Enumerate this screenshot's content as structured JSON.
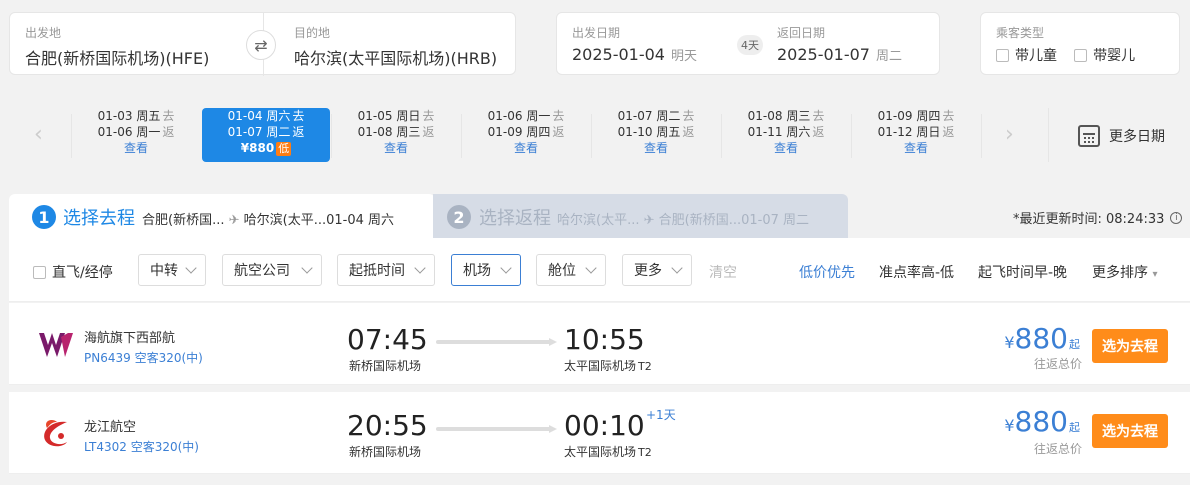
{
  "search": {
    "from_label": "出发地",
    "from_value": "合肥(新桥国际机场)(HFE)",
    "to_label": "目的地",
    "to_value": "哈尔滨(太平国际机场)(HRB)",
    "depart_label": "出发日期",
    "depart_date": "2025-01-04",
    "depart_day": "明天",
    "days_count": "4天",
    "return_label": "返回日期",
    "return_date": "2025-01-07",
    "return_day": "周二",
    "pax_label": "乘客类型",
    "pax_child": "带儿童",
    "pax_infant": "带婴儿"
  },
  "date_strip": {
    "cells": [
      {
        "go": "01-03 周五",
        "go_tag": "去",
        "ret": "01-06 周一",
        "ret_tag": "返",
        "action": "查看"
      },
      {
        "go": "01-04 周六",
        "go_tag": "去",
        "ret": "01-07 周二",
        "ret_tag": "返",
        "price": "¥880",
        "low": "低"
      },
      {
        "go": "01-05 周日",
        "go_tag": "去",
        "ret": "01-08 周三",
        "ret_tag": "返",
        "action": "查看"
      },
      {
        "go": "01-06 周一",
        "go_tag": "去",
        "ret": "01-09 周四",
        "ret_tag": "返",
        "action": "查看"
      },
      {
        "go": "01-07 周二",
        "go_tag": "去",
        "ret": "01-10 周五",
        "ret_tag": "返",
        "action": "查看"
      },
      {
        "go": "01-08 周三",
        "go_tag": "去",
        "ret": "01-11 周六",
        "ret_tag": "返",
        "action": "查看"
      },
      {
        "go": "01-09 周四",
        "go_tag": "去",
        "ret": "01-12 周日",
        "ret_tag": "返",
        "action": "查看"
      }
    ],
    "more_dates": "更多日期"
  },
  "steps": {
    "step1_num": "1",
    "step1_title": "选择去程",
    "step1_route": "合肥(新桥国...",
    "step1_route_to": "哈尔滨(太平...01-04 周六",
    "step2_num": "2",
    "step2_title": "选择返程",
    "step2_route": "哈尔滨(太平...",
    "step2_route_to": "合肥(新桥国...01-07 周二",
    "update_text": "*最近更新时间: 08:24:33",
    "info_icon": "i"
  },
  "filters": {
    "direct": "直飞/经停",
    "transfer": "中转",
    "airline": "航空公司",
    "time": "起抵时间",
    "airport": "机场",
    "cabin": "舱位",
    "more": "更多",
    "clear": "清空",
    "sort_low": "低价优先",
    "sort_ontime": "准点率高-低",
    "sort_dep": "起飞时间早-晚",
    "sort_more": "更多排序"
  },
  "flights": [
    {
      "airline": "海航旗下西部航",
      "flight_no": "PN6439 空客320(中)",
      "dep_time": "07:45",
      "dep_airport": "新桥国际机场",
      "arr_time": "10:55",
      "arr_airport": "太平国际机场",
      "arr_terminal": "T2",
      "plus_day": "",
      "price_symbol": "¥",
      "price": "880",
      "price_suffix": "起",
      "price_note": "往返总价",
      "select": "选为去程",
      "logo_color": "#8b1a5e"
    },
    {
      "airline": "龙江航空",
      "flight_no": "LT4302 空客320(中)",
      "dep_time": "20:55",
      "dep_airport": "新桥国际机场",
      "arr_time": "00:10",
      "arr_airport": "太平国际机场",
      "arr_terminal": "T2",
      "plus_day": "+1天",
      "price_symbol": "¥",
      "price": "880",
      "price_suffix": "起",
      "price_note": "往返总价",
      "select": "选为去程",
      "logo_color": "#d42a2a"
    }
  ]
}
